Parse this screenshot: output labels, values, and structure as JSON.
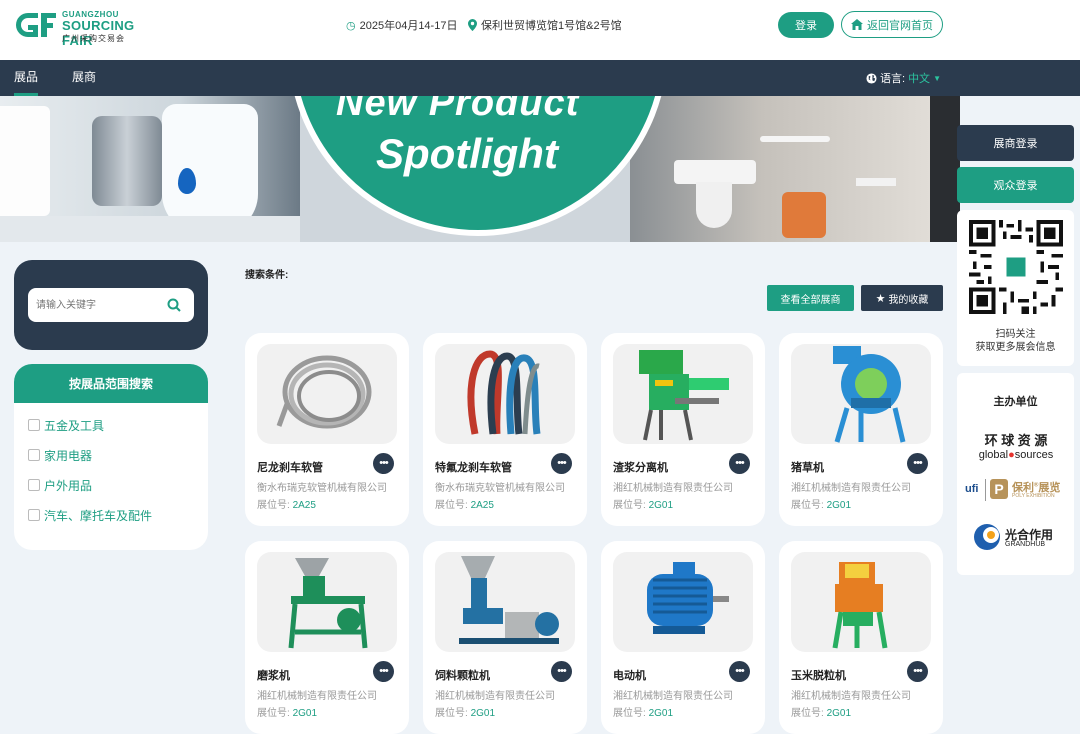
{
  "header": {
    "logo": {
      "line1": "GUANGZHOU",
      "line2": "SOURCING FAIR",
      "line3": "广州采购交易会"
    },
    "date": "2025年04月14-17日",
    "venue": "保利世贸博览馆1号馆&2号馆",
    "login_label": "登录",
    "home_label": "返回官网首页"
  },
  "nav": {
    "tabs": [
      {
        "label": "展品",
        "active": true
      },
      {
        "label": "展商",
        "active": false
      }
    ],
    "language_label": "语言:",
    "language_value": "中文"
  },
  "banner": {
    "line1": "New Product",
    "line2": "Spotlight"
  },
  "side": {
    "exhibitor_login": "展商登录",
    "visitor_login": "观众登录",
    "qr_text_1": "扫码关注",
    "qr_text_2": "获取更多展会信息",
    "organizers_title": "主办单位",
    "organizers": [
      {
        "line1": "环 球 资 源",
        "line2a": "global",
        "line2b": "sources"
      },
      {
        "left": "ufi",
        "main": "保利",
        "sup": "®",
        "suffix": "展览",
        "sub": "POLY EXHIBITION"
      },
      {
        "main": "光合作用",
        "sub": "GRANDHUB"
      }
    ]
  },
  "search": {
    "placeholder": "请输入关键字"
  },
  "categories": {
    "title": "按展品范围搜索",
    "items": [
      "五金及工具",
      "家用电器",
      "户外用品",
      "汽车、摩托车及配件"
    ]
  },
  "toolbar": {
    "conditions_label": "搜索条件:",
    "all_exhibitors": "查看全部展商",
    "favorites": "我的收藏"
  },
  "products": [
    {
      "name": "尼龙刹车软管",
      "company": "衡水布瑞克软管机械有限公司",
      "booth_label": "展位号:",
      "booth": "2A25",
      "image": "steel-braided-hose"
    },
    {
      "name": "特氟龙刹车软管",
      "company": "衡水布瑞克软管机械有限公司",
      "booth_label": "展位号:",
      "booth": "2A25",
      "image": "colored-brake-hoses"
    },
    {
      "name": "渣浆分离机",
      "company": "湘红机械制造有限责任公司",
      "booth_label": "展位号:",
      "booth": "2G01",
      "image": "green-separator-machine"
    },
    {
      "name": "猪草机",
      "company": "湘红机械制造有限责任公司",
      "booth_label": "展位号:",
      "booth": "2G01",
      "image": "blue-forage-cutter"
    },
    {
      "name": "磨浆机",
      "company": "湘红机械制造有限责任公司",
      "booth_label": "展位号:",
      "booth": "2G01",
      "image": "green-grinding-mill"
    },
    {
      "name": "饲料颗粒机",
      "company": "湘红机械制造有限责任公司",
      "booth_label": "展位号:",
      "booth": "2G01",
      "image": "blue-pellet-mill"
    },
    {
      "name": "电动机",
      "company": "湘红机械制造有限责任公司",
      "booth_label": "展位号:",
      "booth": "2G01",
      "image": "blue-electric-motor"
    },
    {
      "name": "玉米脱粒机",
      "company": "湘红机械制造有限责任公司",
      "booth_label": "展位号:",
      "booth": "2G01",
      "image": "orange-corn-thresher"
    }
  ],
  "colors": {
    "brand": "#1e9e83",
    "navy": "#2b3b4e",
    "background": "#eef3f8"
  }
}
